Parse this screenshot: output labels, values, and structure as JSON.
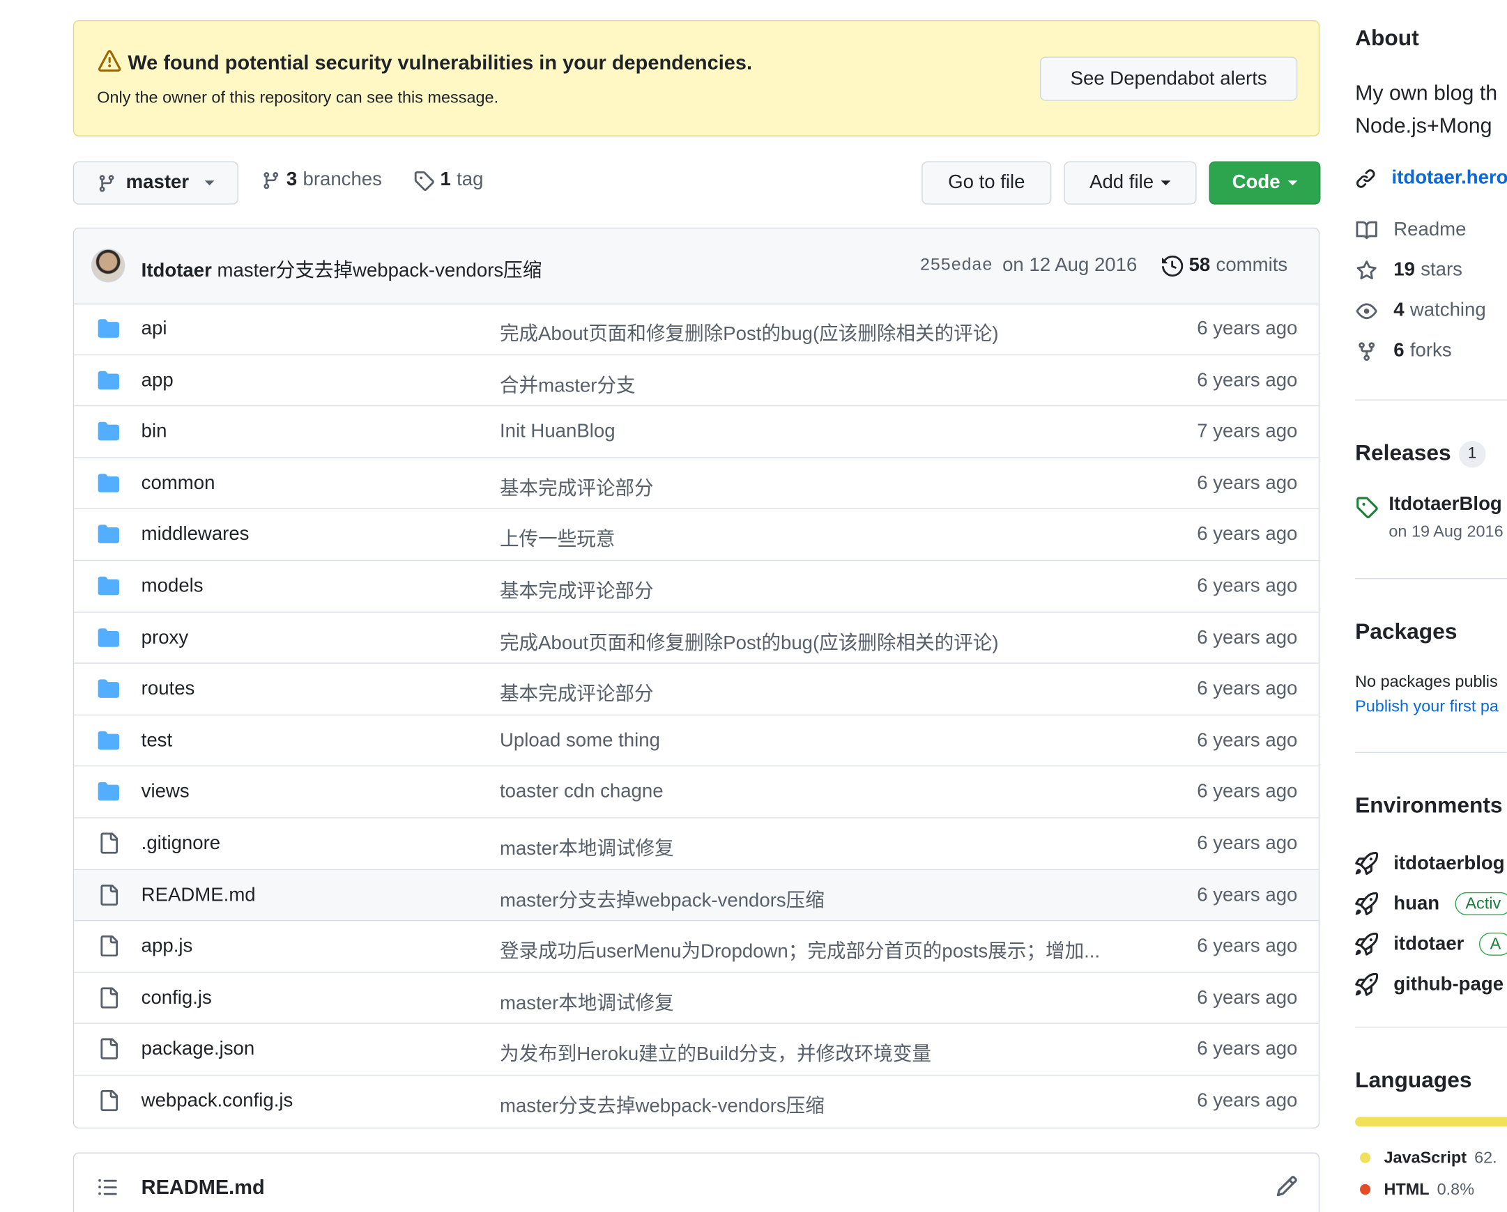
{
  "alert": {
    "title": "We found potential security vulnerabilities in your dependencies.",
    "subtitle": "Only the owner of this repository can see this message.",
    "button": "See Dependabot alerts"
  },
  "toolbar": {
    "branch": "master",
    "branches_count": "3",
    "branches_label": "branches",
    "tags_count": "1",
    "tags_label": "tag",
    "go_to_file": "Go to file",
    "add_file": "Add file",
    "code": "Code"
  },
  "latest_commit": {
    "author": "Itdotaer",
    "message": "master分支去掉webpack-vendors压缩",
    "sha": "255edae",
    "date": "on 12 Aug 2016",
    "commits_count": "58",
    "commits_label": "commits"
  },
  "files": [
    {
      "type": "dir",
      "name": "api",
      "message": "完成About页面和修复删除Post的bug(应该删除相关的评论)",
      "age": "6 years ago"
    },
    {
      "type": "dir",
      "name": "app",
      "message": "合并master分支",
      "age": "6 years ago"
    },
    {
      "type": "dir",
      "name": "bin",
      "message": "Init HuanBlog",
      "age": "7 years ago"
    },
    {
      "type": "dir",
      "name": "common",
      "message": "基本完成评论部分",
      "age": "6 years ago"
    },
    {
      "type": "dir",
      "name": "middlewares",
      "message": "上传一些玩意",
      "age": "6 years ago"
    },
    {
      "type": "dir",
      "name": "models",
      "message": "基本完成评论部分",
      "age": "6 years ago"
    },
    {
      "type": "dir",
      "name": "proxy",
      "message": "完成About页面和修复删除Post的bug(应该删除相关的评论)",
      "age": "6 years ago"
    },
    {
      "type": "dir",
      "name": "routes",
      "message": "基本完成评论部分",
      "age": "6 years ago"
    },
    {
      "type": "dir",
      "name": "test",
      "message": "Upload some thing",
      "age": "6 years ago"
    },
    {
      "type": "dir",
      "name": "views",
      "message": "toaster cdn chagne",
      "age": "6 years ago"
    },
    {
      "type": "file",
      "name": ".gitignore",
      "message": "master本地调试修复",
      "age": "6 years ago"
    },
    {
      "type": "file",
      "name": "README.md",
      "message": "master分支去掉webpack-vendors压缩",
      "age": "6 years ago",
      "highlighted": true
    },
    {
      "type": "file",
      "name": "app.js",
      "message": "登录成功后userMenu为Dropdown；完成部分首页的posts展示；增加...",
      "age": "6 years ago"
    },
    {
      "type": "file",
      "name": "config.js",
      "message": "master本地调试修复",
      "age": "6 years ago"
    },
    {
      "type": "file",
      "name": "package.json",
      "message": "为发布到Heroku建立的Build分支，并修改环境变量",
      "age": "6 years ago"
    },
    {
      "type": "file",
      "name": "webpack.config.js",
      "message": "master分支去掉webpack-vendors压缩",
      "age": "6 years ago"
    }
  ],
  "readme": {
    "title": "README.md"
  },
  "sidebar": {
    "about": {
      "heading": "About",
      "description_line1": "My own blog th",
      "description_line2": "Node.js+Mong",
      "link": "itdotaer.hero",
      "readme": "Readme",
      "stars_count": "19",
      "stars_label": "stars",
      "watching_count": "4",
      "watching_label": "watching",
      "forks_count": "6",
      "forks_label": "forks"
    },
    "releases": {
      "heading": "Releases",
      "count": "1",
      "latest_name": "ItdotaerBlog",
      "latest_date": "on 19 Aug 2016"
    },
    "packages": {
      "heading": "Packages",
      "empty_text": "No packages publis",
      "publish_link": "Publish your first pa"
    },
    "environments": {
      "heading": "Environments",
      "items": [
        {
          "name": "itdotaerblog",
          "badge": ""
        },
        {
          "name": "huan",
          "badge": "Activ"
        },
        {
          "name": "itdotaer",
          "badge": "A"
        },
        {
          "name": "github-page",
          "badge": ""
        }
      ]
    },
    "languages": {
      "heading": "Languages",
      "items": [
        {
          "name": "JavaScript",
          "percent": "62.",
          "color": "#f1e05a"
        },
        {
          "name": "HTML",
          "percent": "0.8%",
          "color": "#e34c26"
        }
      ]
    }
  },
  "colors": {
    "accent": "#0969da",
    "code_button": "#2da44e",
    "folder": "#54aeff",
    "alert_bg": "#fff8c5"
  }
}
